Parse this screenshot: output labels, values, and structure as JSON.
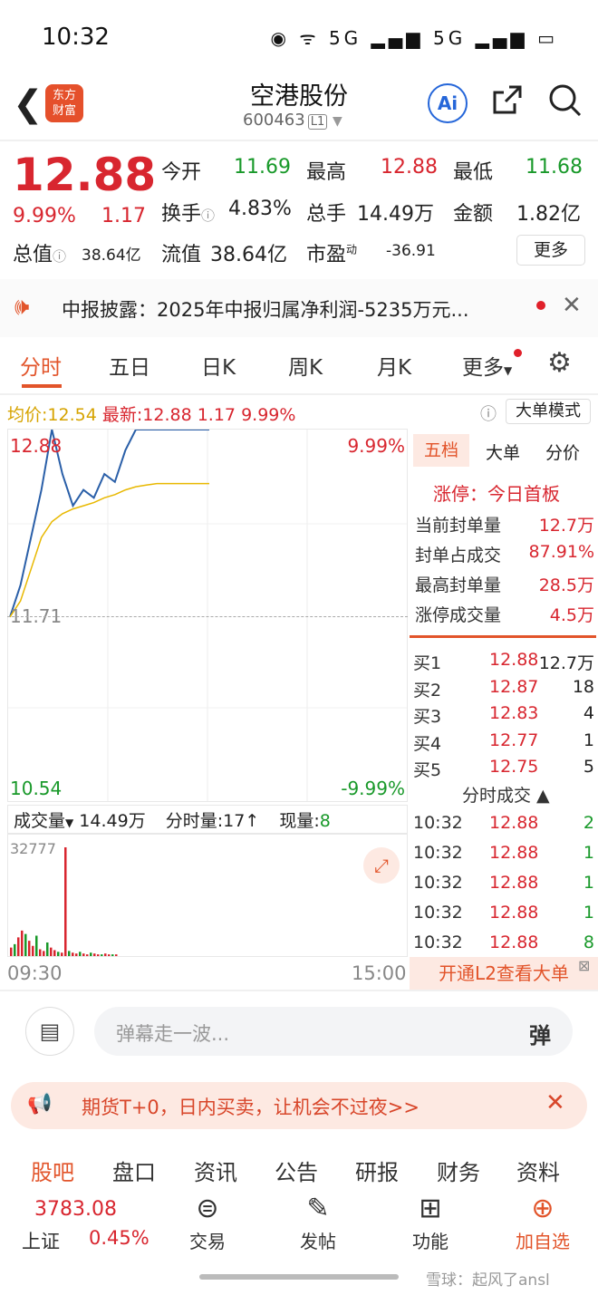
{
  "status": {
    "time": "10:32",
    "icons": "◉ ᯤ 5G ▂▄▆ 5G ▂▄▆ ▭"
  },
  "header": {
    "logo": "东方\n财富",
    "name": "空港股份",
    "code": "600463",
    "level": "L1"
  },
  "quote": {
    "price": "12.88",
    "pct": "9.99%",
    "chg": "1.17",
    "open_label": "今开",
    "open": "11.69",
    "high_label": "最高",
    "high": "12.88",
    "low_label": "最低",
    "low": "11.68",
    "turnover_label": "换手",
    "turnover": "4.83%",
    "vol_label": "总手",
    "vol": "14.49万",
    "amt_label": "金额",
    "amt": "1.82亿",
    "mcap_label": "总值",
    "mcap": "38.64亿",
    "float_label": "流值",
    "float": "38.64亿",
    "pe_label": "市盈",
    "pe_sup": "动",
    "pe": "-36.91",
    "more": "更多"
  },
  "notice": {
    "text": "中报披露：2025年中报归属净利润-5235万元..."
  },
  "tabs": [
    "分时",
    "五日",
    "日K",
    "周K",
    "月K",
    "更多"
  ],
  "infoline": {
    "avg_label": "均价:",
    "avg": "12.54",
    "latest_label": "最新:",
    "latest": "12.88",
    "chg": "1.17",
    "pct": "9.99%",
    "mode": "大单模式"
  },
  "chart": {
    "top_left": "12.88",
    "top_right": "9.99%",
    "mid": "11.71",
    "bottom_left": "10.54",
    "bottom_right": "-9.99%",
    "vol_label": "成交量",
    "vol": "14.49万",
    "fs_label": "分时量:",
    "fs": "17↑",
    "now_label": "现量:",
    "now": "8",
    "vol_max": "32777",
    "t_start": "09:30",
    "t_end": "15:00"
  },
  "chart_data": {
    "type": "line",
    "ylim": [
      10.54,
      12.88
    ],
    "series": [
      {
        "values": [
          11.7,
          11.9,
          12.2,
          12.5,
          12.88,
          12.6,
          12.4,
          12.5,
          12.45,
          12.6,
          12.55,
          12.75,
          12.88,
          12.88,
          12.88,
          12.88,
          12.88,
          12.88,
          12.88,
          12.88
        ]
      },
      {
        "values": [
          11.7,
          11.8,
          12.0,
          12.2,
          12.3,
          12.35,
          12.38,
          12.4,
          12.42,
          12.45,
          12.47,
          12.5,
          12.52,
          12.53,
          12.54,
          12.54,
          12.54,
          12.54,
          12.54,
          12.54
        ]
      }
    ]
  },
  "panel": {
    "tabs": [
      "五档",
      "大单",
      "分价"
    ],
    "limit": "涨停：今日首板",
    "stats": [
      [
        "当前封单量",
        "12.7万"
      ],
      [
        "封单占成交",
        "87.91%"
      ],
      [
        "最高封单量",
        "28.5万"
      ],
      [
        "涨停成交量",
        "4.5万"
      ]
    ],
    "book": [
      [
        "买1",
        "12.88",
        "12.7万"
      ],
      [
        "买2",
        "12.87",
        "18"
      ],
      [
        "买3",
        "12.83",
        "4"
      ],
      [
        "买4",
        "12.77",
        "1"
      ],
      [
        "买5",
        "12.75",
        "5"
      ]
    ],
    "trades_title": "分时成交 ▲",
    "trades": [
      [
        "10:32",
        "12.88",
        "2"
      ],
      [
        "10:32",
        "12.88",
        "1"
      ],
      [
        "10:32",
        "12.88",
        "1"
      ],
      [
        "10:32",
        "12.88",
        "1"
      ],
      [
        "10:32",
        "12.88",
        "8"
      ]
    ],
    "l2": "开通L2查看大单"
  },
  "comment": {
    "placeholder": "弹幕走一波...",
    "btn": "弹"
  },
  "promo": {
    "text": "期货T+0，日内买卖，让机会不过夜>>"
  },
  "bottomtabs": [
    "股吧",
    "盘口",
    "资讯",
    "公告",
    "研报",
    "财务",
    "资料"
  ],
  "nav": {
    "index_val": "3783.08",
    "index_name": "上证",
    "index_pct": "0.45%",
    "items": [
      "交易",
      "发帖",
      "功能",
      "加自选"
    ]
  },
  "watermark": "雪球：起风了ansl"
}
